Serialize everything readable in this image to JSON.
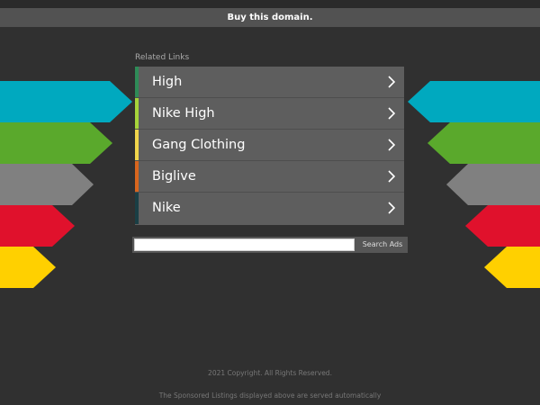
{
  "header": {
    "buy_label": "Buy this domain."
  },
  "related": {
    "title": "Related Links",
    "items": [
      {
        "label": "High",
        "color": "#2e8b57"
      },
      {
        "label": "Nike High",
        "color": "#a6d43a"
      },
      {
        "label": "Gang Clothing",
        "color": "#f1d54b"
      },
      {
        "label": "Biglive",
        "color": "#d9661e"
      },
      {
        "label": "Nike",
        "color": "#1a3f45"
      }
    ]
  },
  "search": {
    "button_label": "Search Ads",
    "placeholder": ""
  },
  "footer": {
    "copyright": "2021 Copyright. All Rights Reserved.",
    "disclaimer": "The Sponsored Listings displayed above are served automatically"
  },
  "colors": {
    "background": "#303030",
    "arrow_colors": [
      "#00a9bf",
      "#5aa92c",
      "#808080",
      "#e0112c",
      "#ffd000"
    ]
  }
}
